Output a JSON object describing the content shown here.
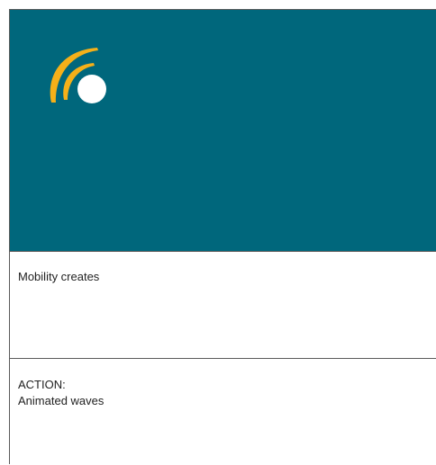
{
  "slide": {
    "caption": "Mobility creates",
    "action_label": "ACTION:",
    "action_text": "Animated waves"
  },
  "colors": {
    "banner_bg": "#00677c",
    "logo_wave": "#f5b019",
    "logo_dot": "#ffffff",
    "divider": "#5a5a5a"
  },
  "icons": {
    "logo": "signal-waves-icon"
  }
}
